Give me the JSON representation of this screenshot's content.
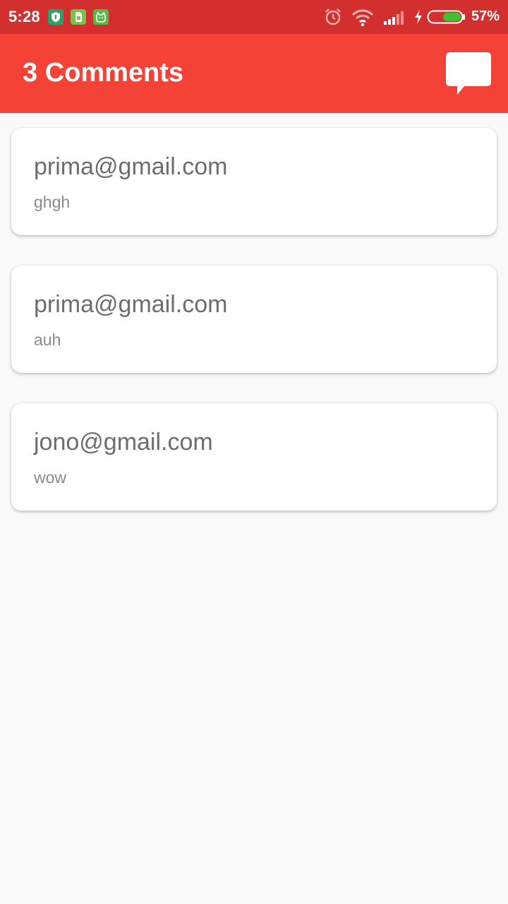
{
  "status_bar": {
    "time": "5:28",
    "battery_percent": "57%",
    "battery_level": 0.57,
    "icons": [
      "shield-icon",
      "sim-card-icon",
      "android-icon",
      "alarm-icon",
      "wifi-icon",
      "signal-icon",
      "charging-icon",
      "battery-icon"
    ]
  },
  "app_bar": {
    "title": "3 Comments",
    "action_icon": "comment-icon",
    "background": "#f44336",
    "status_background": "#d32f2f"
  },
  "comments": [
    {
      "email": "prima@gmail.com",
      "text": "ghgh"
    },
    {
      "email": "prima@gmail.com",
      "text": "auh"
    },
    {
      "email": "jono@gmail.com",
      "text": "wow"
    }
  ]
}
